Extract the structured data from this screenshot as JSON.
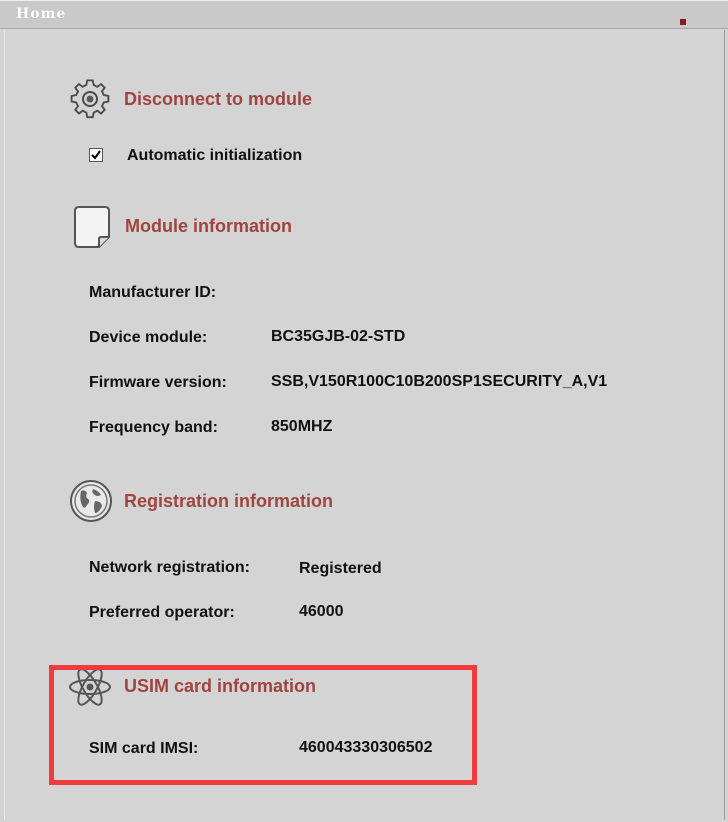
{
  "window": {
    "title": "Home"
  },
  "connection": {
    "button_label": "Disconnect to module",
    "auto_init_label": "Automatic initialization",
    "auto_init_checked": true
  },
  "module": {
    "title": "Module information",
    "manufacturer_label": "Manufacturer ID:",
    "manufacturer_value": "",
    "device_label": "Device module:",
    "device_value": "BC35GJB-02-STD",
    "firmware_label": "Firmware version:",
    "firmware_value": "SSB,V150R100C10B200SP1SECURITY_A,V1",
    "frequency_label": "Frequency band:",
    "frequency_value": "850MHZ"
  },
  "registration": {
    "title": "Registration information",
    "network_label": "Network registration:",
    "network_value": "Registered",
    "operator_label": "Preferred operator:",
    "operator_value": "46000"
  },
  "usim": {
    "title": "USIM card information",
    "imsi_label": "SIM card IMSI:",
    "imsi_value": "460043330306502"
  },
  "colors": {
    "section_title": "#a0443f",
    "highlight": "#ef3b3b",
    "background": "#d4d4d4"
  },
  "icons": {
    "connection": "gear-icon",
    "module": "document-icon",
    "registration": "globe-icon",
    "usim": "atom-icon"
  }
}
